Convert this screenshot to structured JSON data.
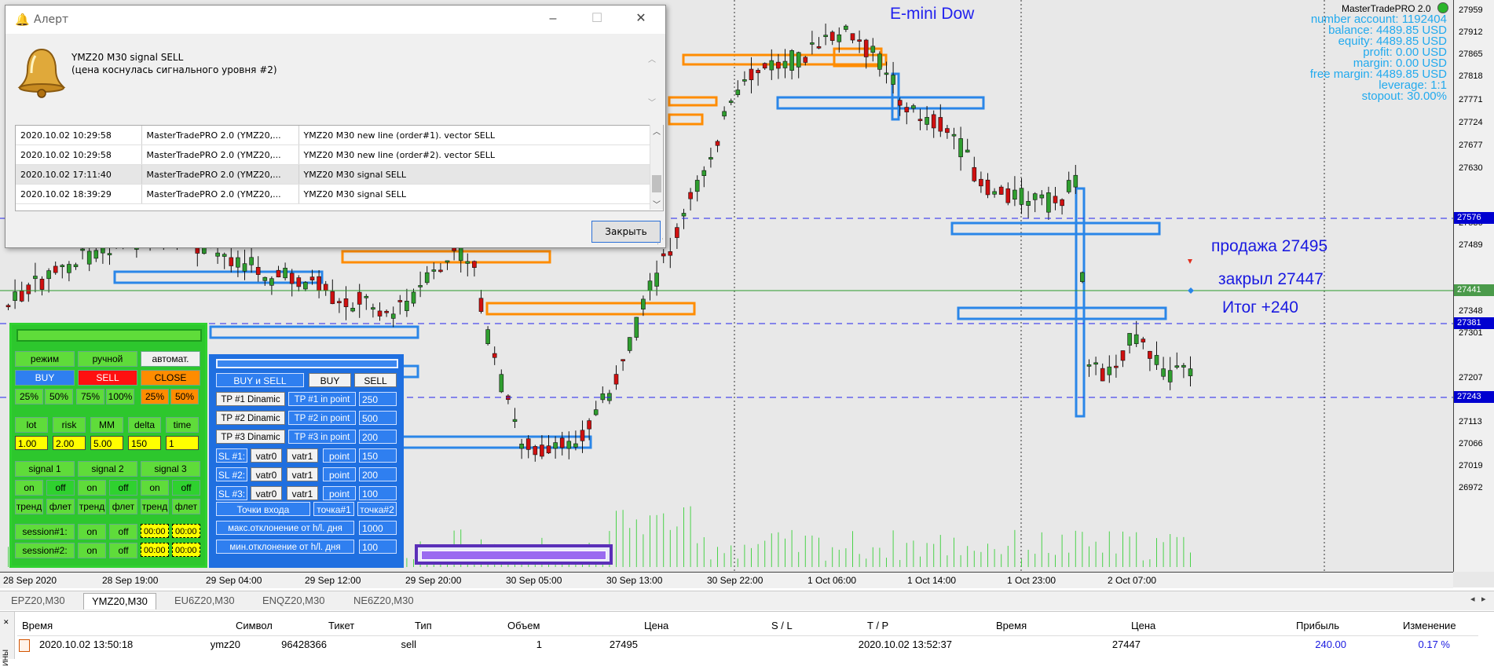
{
  "chart": {
    "instrument_label": "E-mini Dow",
    "info": {
      "ea_name": "MasterTradePRO 2.0",
      "lines": [
        "number account: 1192404",
        "balance: 4489.85 USD",
        "equity: 4489.85 USD",
        "profit: 0.00 USD",
        "margin: 0.00 USD",
        "free margin: 4489.85 USD",
        "leverage: 1:1",
        "stopout: 30.00%"
      ]
    },
    "annotations": [
      "продажа 27495",
      "закрыл 27447",
      "Итог +240"
    ],
    "price_ticks": [
      "27959",
      "27912",
      "27865",
      "27818",
      "27771",
      "27724",
      "27677",
      "27630",
      "27536",
      "27489",
      "27395",
      "27348",
      "27301",
      "27207",
      "27160",
      "27113",
      "27066",
      "27019",
      "26972"
    ],
    "price_labels": [
      {
        "text": "27576",
        "bg": "#0000d0"
      },
      {
        "text": "27441",
        "bg": "#4a9a4a"
      },
      {
        "text": "27381",
        "bg": "#0000d0"
      },
      {
        "text": "27243",
        "bg": "#0000d0"
      }
    ],
    "time_ticks": [
      "28 Sep 2020",
      "28 Sep 19:00",
      "29 Sep 04:00",
      "29 Sep 12:00",
      "29 Sep 20:00",
      "30 Sep 05:00",
      "30 Sep 13:00",
      "30 Sep 22:00",
      "1 Oct 06:00",
      "1 Oct 14:00",
      "1 Oct 23:00",
      "2 Oct 07:00"
    ],
    "colors": {
      "bull": "#2f9e2f",
      "bear": "#d01010",
      "blue_zone": "#2a86e8",
      "orange_zone": "#ff8c00",
      "volume": "#4ad24a"
    }
  },
  "alert": {
    "title": "Алерт",
    "message_line1": "YMZ20 M30 signal SELL",
    "message_line2": "(цена коснулась сигнального уровня #2)",
    "rows": [
      [
        "2020.10.02 10:29:58",
        "MasterTradePRO 2.0 (YMZ20,...",
        "YMZ20 M30 new line (order#1). vector SELL"
      ],
      [
        "2020.10.02 10:29:58",
        "MasterTradePRO 2.0 (YMZ20,...",
        "YMZ20 M30 new line (order#2). vector SELL"
      ],
      [
        "2020.10.02 17:11:40",
        "MasterTradePRO 2.0 (YMZ20,...",
        "YMZ20 M30 signal SELL"
      ],
      [
        "2020.10.02 18:39:29",
        "MasterTradePRO 2.0 (YMZ20,...",
        "YMZ20 M30 signal SELL"
      ]
    ],
    "close_label": "Закрыть"
  },
  "left_panel": {
    "mode": [
      "режим",
      "ручной",
      "автомат."
    ],
    "trade": [
      "BUY",
      "SELL",
      "CLOSE"
    ],
    "pct": [
      "25%",
      "50%",
      "75%",
      "100%",
      "25%",
      "50%"
    ],
    "params_labels": [
      "lot",
      "risk",
      "MM",
      "delta",
      "time"
    ],
    "params_values": [
      "1.00",
      "2.00",
      "5.00",
      "150",
      "1"
    ],
    "signals": [
      "signal 1",
      "signal 2",
      "signal 3"
    ],
    "onoff": [
      "on",
      "off",
      "on",
      "off",
      "on",
      "off"
    ],
    "trend": [
      "тренд",
      "флет",
      "тренд",
      "флет",
      "тренд",
      "флет"
    ],
    "sessions": [
      {
        "label": "session#1:",
        "on": "on",
        "off": "off",
        "from": "00:00",
        "to": "00:00"
      },
      {
        "label": "session#2:",
        "on": "on",
        "off": "off",
        "from": "00:00",
        "to": "00:00"
      }
    ]
  },
  "right_panel": {
    "top": [
      "BUY и SELL",
      "BUY",
      "SELL"
    ],
    "tp_rows": [
      {
        "label": "TP #1 Dinamic",
        "mode": "TP #1 in point",
        "value": "250"
      },
      {
        "label": "TP #2 Dinamic",
        "mode": "TP #2 in point",
        "value": "500"
      },
      {
        "label": "TP #3 Dinamic",
        "mode": "TP #3 in point",
        "value": "200"
      }
    ],
    "sl_rows": [
      {
        "label": "SL #1:",
        "a": "vatr0",
        "b": "vatr1",
        "c": "point",
        "value": "150"
      },
      {
        "label": "SL #2:",
        "a": "vatr0",
        "b": "vatr1",
        "c": "point",
        "value": "200"
      },
      {
        "label": "SL #3:",
        "a": "vatr0",
        "b": "vatr1",
        "c": "point",
        "value": "100"
      }
    ],
    "entry": [
      "Точки входа",
      "точка#1",
      "точка#2"
    ],
    "dev_rows": [
      {
        "label": "макс.отклонение от h/l. дня",
        "value": "1000"
      },
      {
        "label": "мин.отклонение от h/l. дня",
        "value": "100"
      }
    ]
  },
  "tabs": [
    "EPZ20,M30",
    "YMZ20,M30",
    "EU6Z20,M30",
    "ENQZ20,M30",
    "NE6Z20,M30"
  ],
  "active_tab": 1,
  "terminal": {
    "side_label": "ИНЫ",
    "headers": [
      "Время",
      "Символ",
      "Тикет",
      "Тип",
      "Объем",
      "Цена",
      "S / L",
      "T / P",
      "Время",
      "Цена",
      "Прибыль",
      "Изменение"
    ],
    "row": [
      "2020.10.02 13:50:18",
      "ymz20",
      "96428366",
      "sell",
      "1",
      "27495",
      "",
      "",
      "2020.10.02 13:52:37",
      "27447",
      "240.00",
      "0.17 %"
    ]
  }
}
